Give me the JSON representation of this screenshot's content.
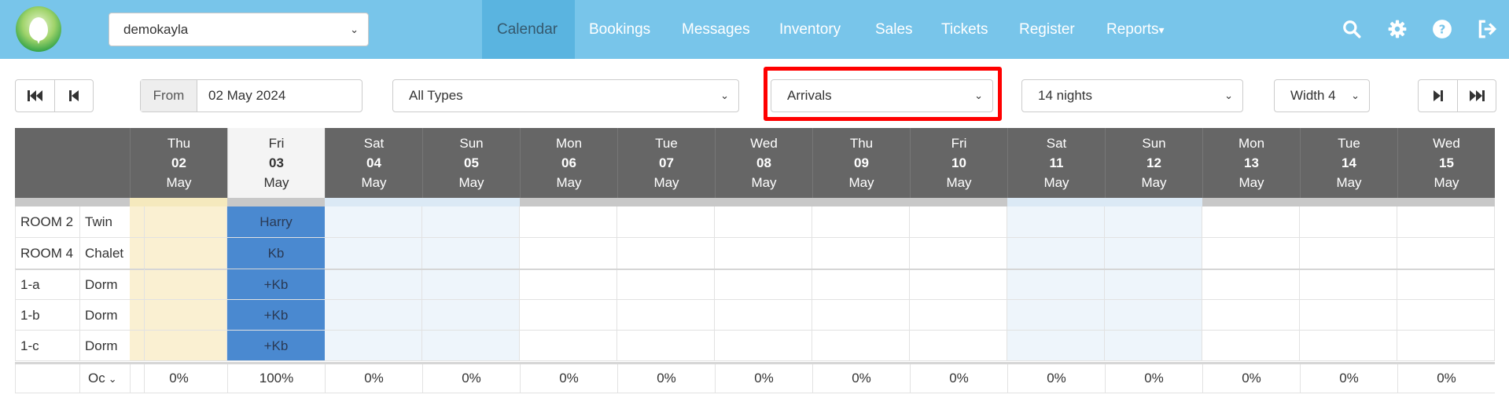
{
  "nav": {
    "property": "demokayla",
    "items": [
      "Calendar",
      "Bookings",
      "Messages",
      "Inventory",
      "Sales",
      "Tickets",
      "Register",
      "Reports"
    ],
    "active": "Calendar",
    "reports_caret": "▾"
  },
  "toolbar": {
    "from_label": "From",
    "from_value": "02 May 2024",
    "type_filter": "All Types",
    "mode_filter": "Arrivals",
    "nights": "14 nights",
    "width": "Width 4"
  },
  "calendar": {
    "days": [
      {
        "dow": "Thu",
        "day": "02",
        "month": "May"
      },
      {
        "dow": "Fri",
        "day": "03",
        "month": "May"
      },
      {
        "dow": "Sat",
        "day": "04",
        "month": "May"
      },
      {
        "dow": "Sun",
        "day": "05",
        "month": "May"
      },
      {
        "dow": "Mon",
        "day": "06",
        "month": "May"
      },
      {
        "dow": "Tue",
        "day": "07",
        "month": "May"
      },
      {
        "dow": "Wed",
        "day": "08",
        "month": "May"
      },
      {
        "dow": "Thu",
        "day": "09",
        "month": "May"
      },
      {
        "dow": "Fri",
        "day": "10",
        "month": "May"
      },
      {
        "dow": "Sat",
        "day": "11",
        "month": "May"
      },
      {
        "dow": "Sun",
        "day": "12",
        "month": "May"
      },
      {
        "dow": "Mon",
        "day": "13",
        "month": "May"
      },
      {
        "dow": "Tue",
        "day": "14",
        "month": "May"
      },
      {
        "dow": "Wed",
        "day": "15",
        "month": "May"
      }
    ],
    "rooms": [
      {
        "room": "ROOM 2",
        "type": "Twin",
        "booking": "Harry"
      },
      {
        "room": "ROOM 4",
        "type": "Chalet",
        "booking": "Kb"
      },
      {
        "room": "1-a",
        "type": "Dorm",
        "booking": "+Kb"
      },
      {
        "room": "1-b",
        "type": "Dorm",
        "booking": "+Kb"
      },
      {
        "room": "1-c",
        "type": "Dorm",
        "booking": "+Kb"
      }
    ],
    "occupancy_label": "Oc",
    "occupancy": [
      "0%",
      "100%",
      "0%",
      "0%",
      "0%",
      "0%",
      "0%",
      "0%",
      "0%",
      "0%",
      "0%",
      "0%",
      "0%",
      "0%"
    ]
  },
  "colors": {
    "navbar": "#78c5ea",
    "header": "#666666",
    "booking": "#4a89d0",
    "highlight": "#ff0000"
  }
}
